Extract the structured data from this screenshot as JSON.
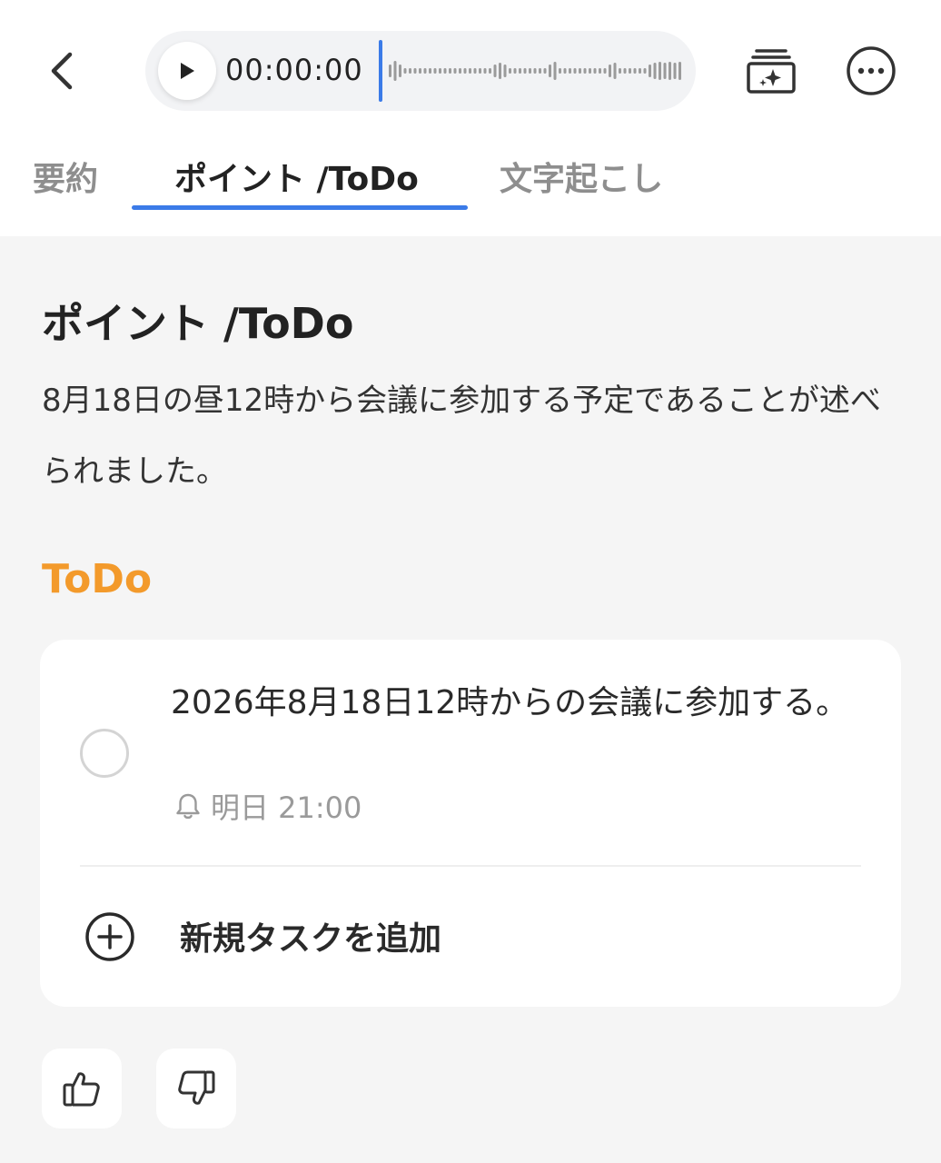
{
  "header": {
    "back_icon": "chevron-left-icon",
    "player": {
      "time": "00:00:00",
      "play_icon": "play-icon"
    },
    "ai_summary_icon": "sparkle-cards-icon",
    "more_icon": "more-horizontal-icon"
  },
  "tabs": [
    {
      "label": "要約",
      "active": false
    },
    {
      "label": "ポイント /ToDo",
      "active": true
    },
    {
      "label": "文字起こし",
      "active": false
    }
  ],
  "points": {
    "title": "ポイント /ToDo",
    "summary": "8月18日の昼12時から会議に参加する予定であることが述べられました。"
  },
  "todo": {
    "heading": "ToDo",
    "items": [
      {
        "text": "2026年8月18日12時からの会議に参加する。",
        "done": false,
        "reminder": "明日 21:00"
      }
    ],
    "add_label": "新規タスクを追加"
  },
  "feedback": {
    "like_icon": "thumbs-up-icon",
    "dislike_icon": "thumbs-down-icon"
  },
  "colors": {
    "accent": "#3b7be8",
    "todo_heading": "#f39a2b",
    "background": "#f5f5f5"
  }
}
